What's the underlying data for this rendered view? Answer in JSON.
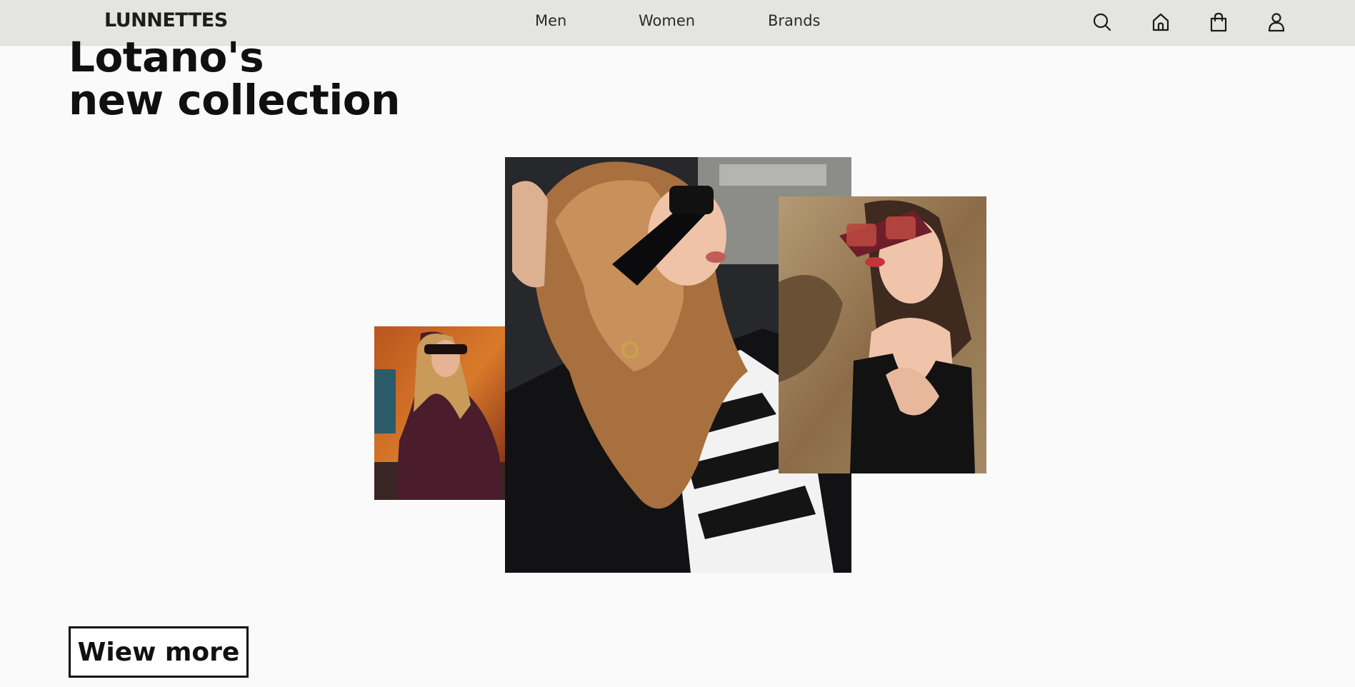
{
  "header": {
    "logo": "LUNNETTES",
    "nav": [
      {
        "label": "Men"
      },
      {
        "label": "Women"
      },
      {
        "label": "Brands"
      }
    ],
    "icons": [
      "search-icon",
      "home-icon",
      "shopping-bag-icon",
      "user-icon"
    ]
  },
  "hero": {
    "title_line1": "Lotano's",
    "title_line2": "new collection",
    "cta_label": "Wiew more"
  },
  "colors": {
    "navbar_bg": "#e4e4e0",
    "page_bg": "#fafafa",
    "text": "#111111"
  }
}
